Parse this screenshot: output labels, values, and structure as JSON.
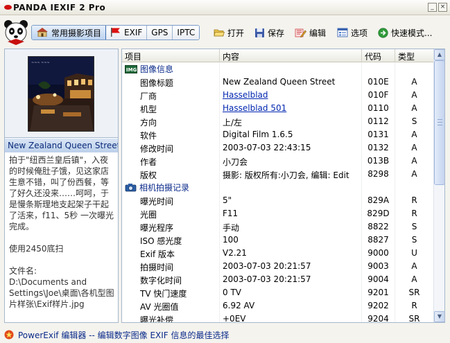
{
  "app": {
    "title": "PANDA IEXIF 2 Pro"
  },
  "window_controls": {
    "minimize": "_",
    "close": "×"
  },
  "toolbar": {
    "tabs": [
      {
        "label": "常用摄影项目",
        "active": true
      },
      {
        "label": "EXIF"
      },
      {
        "label": "GPS"
      },
      {
        "label": "IPTC"
      }
    ],
    "open_label": "打开",
    "save_label": "保存",
    "edit_label": "编辑",
    "options_label": "选项",
    "quick_mode_label": "快速模式..."
  },
  "left_panel": {
    "caption": "New Zealand Queen Street",
    "description": "拍于\"纽西兰皇后镇\"，入夜的时候俺肚子饿，见这家店生意不错，叫了份西餐，等了好久还没来……呵呵，于是慢条斯理地支起架子干起了活来，f11、5秒 一次曝光完成。\n\n使用2450底扫\n\n文件名:\nD:\\Documents and Settings\\Joe\\桌面\\各机型图片样张\\Exif样片.jpg"
  },
  "table": {
    "columns": [
      "项目",
      "内容",
      "代码",
      "类型"
    ],
    "groups": [
      {
        "title": "图像信息",
        "icon": "image-info-icon",
        "rows": [
          {
            "name": "图像标题",
            "value": "New Zealand Queen Street",
            "code": "010E",
            "type": "A"
          },
          {
            "name": "厂商",
            "value": "Hasselblad",
            "code": "010F",
            "type": "A",
            "link": true
          },
          {
            "name": "机型",
            "value": "Hasselblad 501",
            "code": "0110",
            "type": "A",
            "link": true
          },
          {
            "name": "方向",
            "value": "上/左",
            "code": "0112",
            "type": "S"
          },
          {
            "name": "软件",
            "value": "Digital Film 1.6.5",
            "code": "0131",
            "type": "A"
          },
          {
            "name": "修改时间",
            "value": "2003-07-03 22:43:15",
            "code": "0132",
            "type": "A"
          },
          {
            "name": "作者",
            "value": "小刀会",
            "code": "013B",
            "type": "A"
          },
          {
            "name": "版权",
            "value": "摄影: 版权所有:小刀会, 编辑: Edit",
            "code": "8298",
            "type": "A"
          }
        ]
      },
      {
        "title": "相机拍摄记录",
        "icon": "camera-icon",
        "rows": [
          {
            "name": "曝光时间",
            "value": "5\"",
            "code": "829A",
            "type": "R"
          },
          {
            "name": "光圈",
            "value": "F11",
            "code": "829D",
            "type": "R"
          },
          {
            "name": "曝光程序",
            "value": "手动",
            "code": "8822",
            "type": "S"
          },
          {
            "name": "ISO 感光度",
            "value": "100",
            "code": "8827",
            "type": "S"
          },
          {
            "name": "Exif 版本",
            "value": "V2.21",
            "code": "9000",
            "type": "U"
          },
          {
            "name": "拍摄时间",
            "value": "2003-07-03 20:21:57",
            "code": "9003",
            "type": "A"
          },
          {
            "name": "数字化时间",
            "value": "2003-07-03 20:21:57",
            "code": "9004",
            "type": "A"
          },
          {
            "name": "TV 快门速度",
            "value": "0 TV",
            "code": "9201",
            "type": "SR"
          },
          {
            "name": "AV 光圈值",
            "value": "6.92 AV",
            "code": "9202",
            "type": "R"
          },
          {
            "name": "曝光补偿",
            "value": "+0EV",
            "code": "9204",
            "type": "SR"
          }
        ]
      }
    ]
  },
  "status": {
    "text": "PowerExif 编辑器 -- 编辑数字图像 EXIF 信息的最佳选择"
  }
}
